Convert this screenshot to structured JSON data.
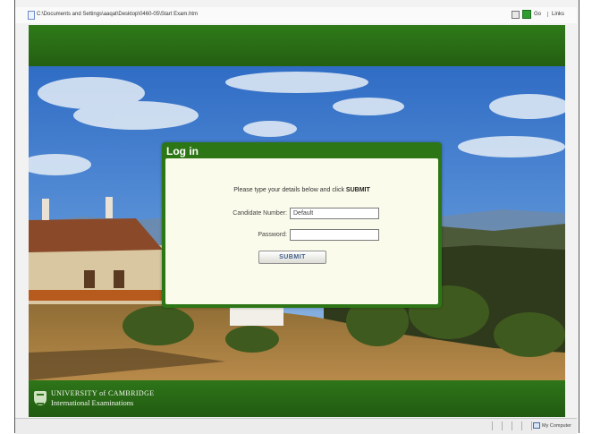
{
  "browser": {
    "address": "C:\\Documents and Settings\\aaqat\\Desktop\\0460-05\\Start Exam.htm",
    "go_label": "Go",
    "links_label": "Links"
  },
  "login": {
    "title": "Log in",
    "instruction_prefix": "Please type your details below and click ",
    "instruction_action": "SUBMIT",
    "candidate_label": "Candidate Number:",
    "candidate_value": "Default",
    "password_label": "Password:",
    "password_value": "",
    "submit_label": "SUBMIT"
  },
  "footer": {
    "line1": "UNIVERSITY of CAMBRIDGE",
    "line2": "International Examinations"
  },
  "statusbar": {
    "zone_label": "My Computer"
  },
  "colors": {
    "header_green": "#2f7a19",
    "panel_green": "#2d7616",
    "panel_background": "#fbfbec",
    "submit_text": "#3e5c8a"
  }
}
